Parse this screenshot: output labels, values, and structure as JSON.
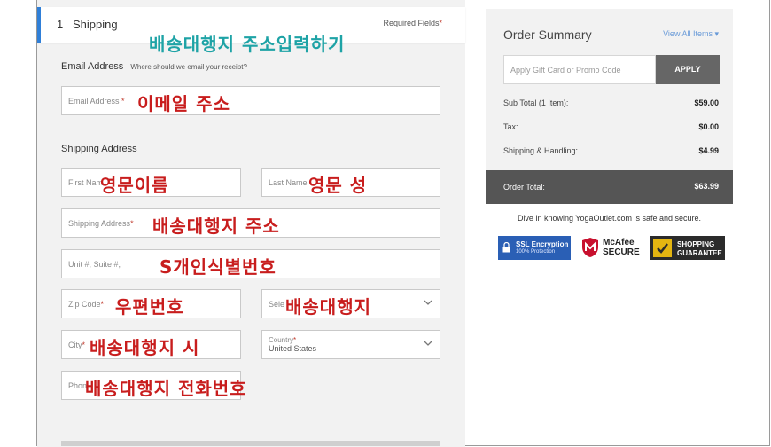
{
  "step": {
    "number": "1",
    "title": "Shipping",
    "required_text": "Required Fields",
    "required_mark": "*"
  },
  "overlays": {
    "section": "배송대행지 주소입력하기",
    "email": "이메일 주소",
    "first_name": "영문이름",
    "last_name": "영문 성",
    "address": "배송대행지 주소",
    "unit": "S개인식별번호",
    "zip": "우편번호",
    "state": "배송대행지",
    "city": "배송대행지 시",
    "phone": "배송대행지 전화번호"
  },
  "email_section": {
    "label": "Email Address",
    "hint": "Where should we email your receipt?"
  },
  "shipping_section": {
    "label": "Shipping Address"
  },
  "fields": {
    "email": "Email Address",
    "first_name": "First Nam",
    "last_name": "Last Name",
    "address": "Shipping Address",
    "unit": "Unit #, Suite #,",
    "zip": "Zip Code",
    "state": "Sele",
    "city": "City",
    "country_label": "Country",
    "country_value": "United States",
    "phone": "Phon"
  },
  "summary": {
    "title": "Order Summary",
    "view_all": "View All Items",
    "promo_placeholder": "Apply Gift Card or Promo Code",
    "apply": "APPLY",
    "subtotal_label": "Sub Total (1 Item):",
    "subtotal_value": "$59.00",
    "tax_label": "Tax:",
    "tax_value": "$0.00",
    "shipping_label": "Shipping & Handling:",
    "shipping_value": "$4.99",
    "total_label": "Order Total:",
    "total_value": "$63.99"
  },
  "secure_text": "Dive in knowing YogaOutlet.com is safe and secure.",
  "badges": {
    "ssl_line1": "SSL Encryption",
    "ssl_line2": "100% Protection",
    "mcafee_line1": "McAfee",
    "mcafee_line2": "SECURE",
    "shop_line1": "SHOPPING",
    "shop_line2": "GUARANTEE"
  },
  "colors": {
    "accent": "#2f7fd8",
    "overlay_red": "#c81d1d",
    "overlay_teal": "#1ea3a6",
    "apply_bg": "#666666"
  }
}
